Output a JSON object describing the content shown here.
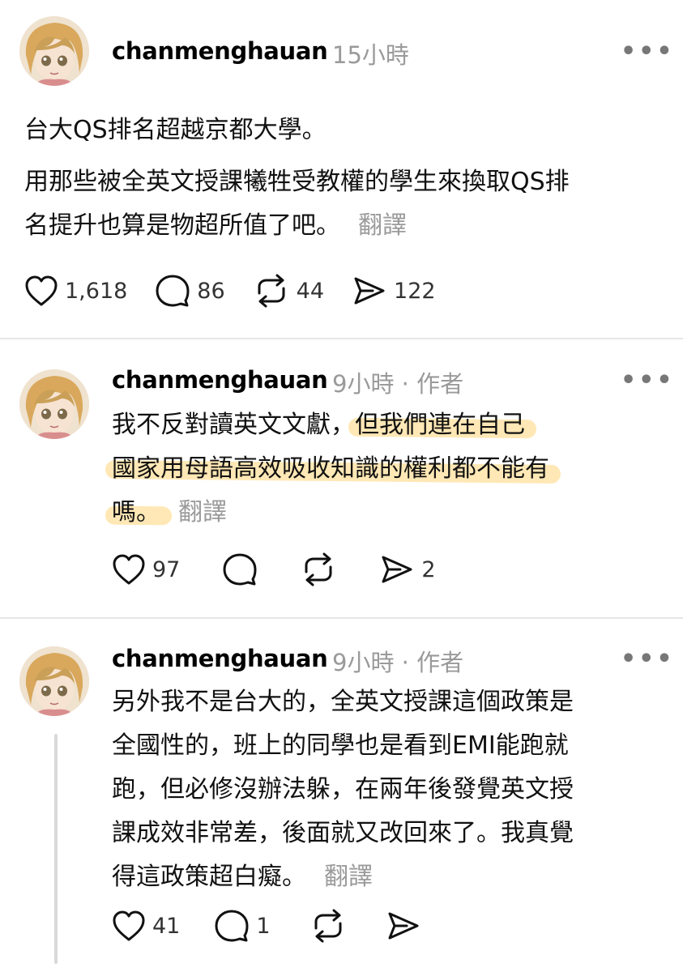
{
  "posts": [
    {
      "username": "chanmenghauan",
      "time": "15小時",
      "author_tag": "",
      "lines": [
        "台大QS排名超越京都大學。",
        "用那些被全英文授課犧牲受教權的學生來換取QS排",
        "名提升也算是物超所值了吧。"
      ],
      "translate": "翻譯",
      "likes": "1,618",
      "comments": "86",
      "reposts": "44",
      "shares": "122"
    },
    {
      "username": "chanmenghauan",
      "time": "9小時",
      "author_tag": "· 作者",
      "line1_plain": "我不反對讀英文文獻，",
      "line1_hl": "但我們連在自己",
      "line2_hl": "國家用母語高效吸收知識的權利都不能有",
      "line3_hl": "嗎。",
      "translate": "翻譯",
      "likes": "97",
      "comments": "",
      "reposts": "",
      "shares": "2"
    },
    {
      "username": "chanmenghauan",
      "time": "9小時",
      "author_tag": "· 作者",
      "lines": [
        "另外我不是台大的，全英文授課這個政策是",
        "全國性的，班上的同學也是看到EMI能跑就",
        "跑，但必修沒辦法躲，在兩年後發覺英文授",
        "課成效非常差，後面就又改回來了。我真覺",
        "得這政策超白癡。"
      ],
      "translate": "翻譯",
      "likes": "41",
      "comments": "1",
      "reposts": "",
      "shares": ""
    }
  ],
  "more_label": "•••",
  "highlight_color": "#ffd678"
}
